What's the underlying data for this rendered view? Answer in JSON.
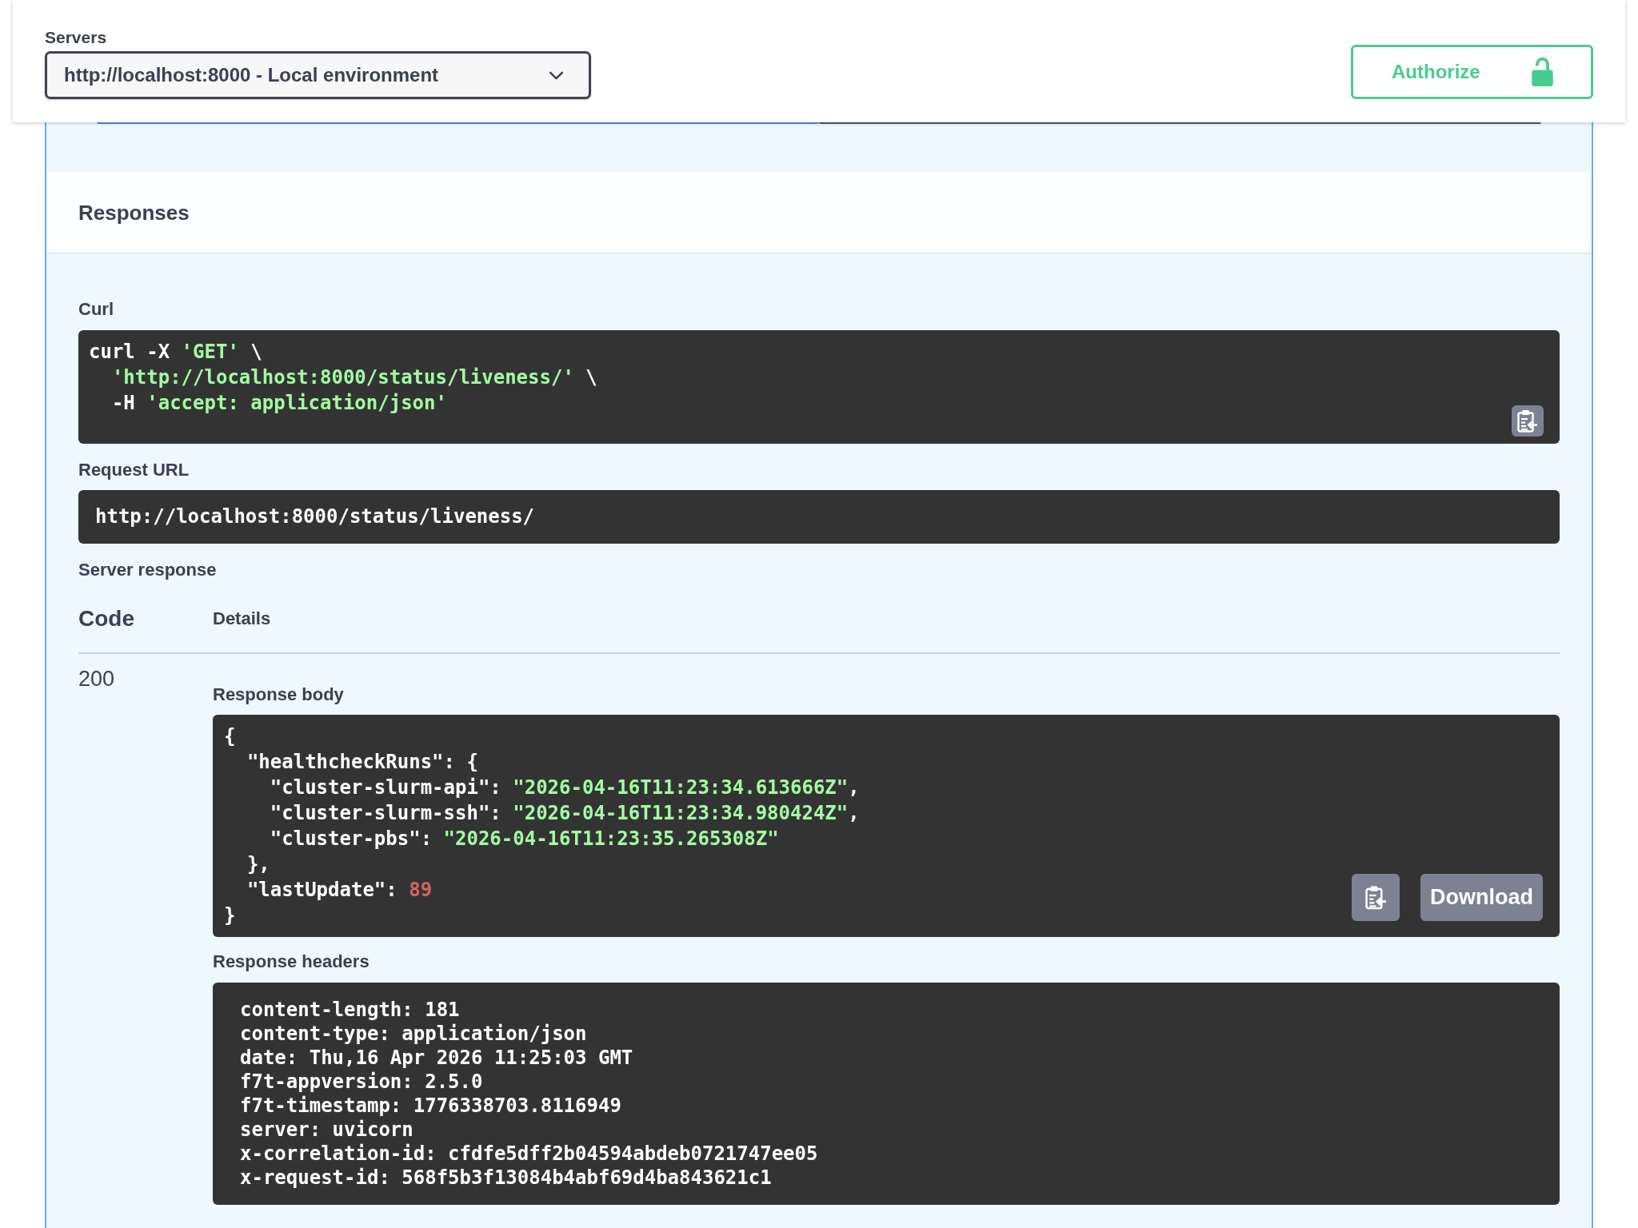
{
  "servers": {
    "label": "Servers",
    "value": "http://localhost:8000 - Local environment"
  },
  "authorize_button": {
    "label": "Authorize",
    "authorized": false
  },
  "responses": {
    "title": "Responses",
    "curl": {
      "label": "Curl",
      "lines": [
        [
          {
            "text": "curl -X ",
            "kind": "plain"
          },
          {
            "text": "'GET'",
            "kind": "string"
          },
          {
            "text": " \\",
            "kind": "plain"
          }
        ],
        [
          {
            "text": "  'http://localhost:8000/status/liveness/'",
            "kind": "string"
          },
          {
            "text": " \\",
            "kind": "plain"
          }
        ],
        [
          {
            "text": "  -H ",
            "kind": "plain"
          },
          {
            "text": "'accept: application/json'",
            "kind": "string"
          }
        ]
      ]
    },
    "request_url": {
      "label": "Request URL",
      "value": "http://localhost:8000/status/liveness/"
    },
    "server_response": {
      "label": "Server response",
      "columns": [
        "Code",
        "Details"
      ],
      "rows": [
        {
          "code": "200",
          "response_body": {
            "label": "Response body",
            "lines": [
              [
                {
                  "text": "{",
                  "kind": "plain"
                }
              ],
              [
                {
                  "text": "  \"healthcheckRuns\": {",
                  "kind": "plain"
                }
              ],
              [
                {
                  "text": "    \"cluster-slurm-api\": ",
                  "kind": "plain"
                },
                {
                  "text": "\"2026-04-16T11:23:34.613666Z\"",
                  "kind": "string"
                },
                {
                  "text": ",",
                  "kind": "plain"
                }
              ],
              [
                {
                  "text": "    \"cluster-slurm-ssh\": ",
                  "kind": "plain"
                },
                {
                  "text": "\"2026-04-16T11:23:34.980424Z\"",
                  "kind": "string"
                },
                {
                  "text": ",",
                  "kind": "plain"
                }
              ],
              [
                {
                  "text": "    \"cluster-pbs\": ",
                  "kind": "plain"
                },
                {
                  "text": "\"2026-04-16T11:23:35.265308Z\"",
                  "kind": "string"
                }
              ],
              [
                {
                  "text": "  },",
                  "kind": "plain"
                }
              ],
              [
                {
                  "text": "  \"lastUpdate\": ",
                  "kind": "plain"
                },
                {
                  "text": "89",
                  "kind": "number"
                }
              ],
              [
                {
                  "text": "}",
                  "kind": "plain"
                }
              ]
            ]
          },
          "download_button": "Download",
          "response_headers": {
            "label": "Response headers",
            "lines": [
              "content-length: 181",
              "content-type: application/json",
              "date: Thu,16 Apr 2026 11:25:03 GMT",
              "f7t-appversion: 2.5.0",
              "f7t-timestamp: 1776338703.8116949",
              "server: uvicorn",
              "x-correlation-id: cfdfe5dff2b04594abdeb0721747ee05",
              "x-request-id: 568f5b3f13084b4abf69d4ba843621c1"
            ]
          }
        }
      ]
    }
  }
}
